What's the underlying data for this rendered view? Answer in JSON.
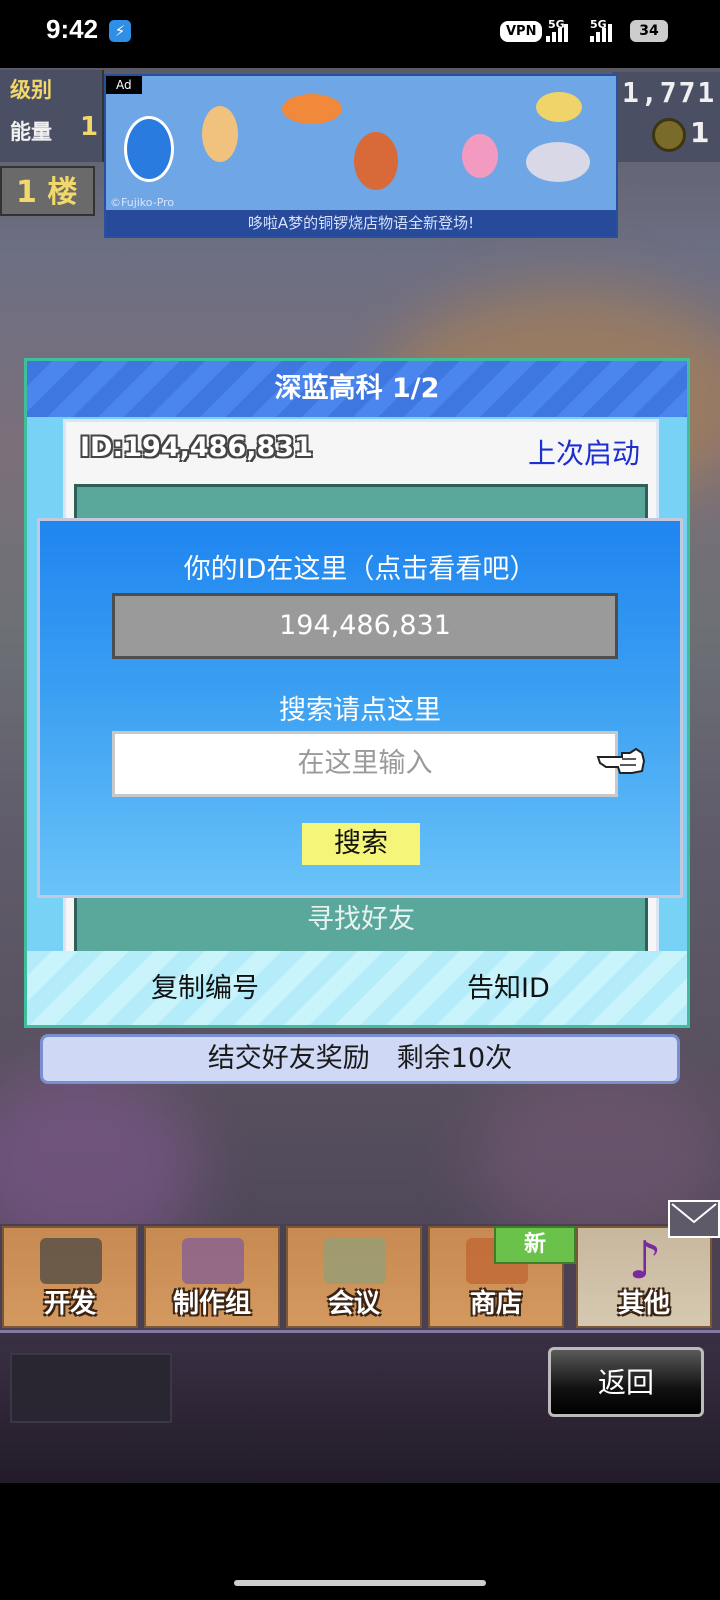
{
  "status_bar": {
    "time": "9:42",
    "vpn": "VPN",
    "net1": "5G",
    "net2": "5G",
    "battery": "34"
  },
  "hud": {
    "level_label": "级别",
    "energy_label": "能量",
    "energy_value": "1",
    "coins": "1,771",
    "gold": "1",
    "floor": "1 楼"
  },
  "ad": {
    "tag": "Ad",
    "copyright": "©Fujiko-Pro",
    "caption": "哆啦A梦的铜锣烧店物语全新登场!"
  },
  "dialog": {
    "title": "深蓝高科 1/2",
    "id_label": "ID:194,486,831",
    "last_launch": "上次启动",
    "find_friends": "寻找好友",
    "copy_id": "复制编号",
    "notify_id": "告知ID"
  },
  "reward": "结交好友奖励　剩余10次",
  "popup": {
    "title": "你的ID在这里（点击看看吧）",
    "my_id": "194,486,831",
    "search_hint": "搜索请点这里",
    "input_placeholder": "在这里输入",
    "search_button": "搜索"
  },
  "menu": {
    "tabs": [
      {
        "label": "开发"
      },
      {
        "label": "制作组"
      },
      {
        "label": "会议"
      },
      {
        "label": "商店"
      },
      {
        "label": "其他"
      }
    ],
    "new_badge": "新"
  },
  "bottom": {
    "back": "返回"
  },
  "colors": {
    "popup_blue": "#1f85f0",
    "dialog_header": "#3f77e0",
    "search_yellow": "#f5f57a",
    "last_launch_blue": "#1c2fd0"
  }
}
